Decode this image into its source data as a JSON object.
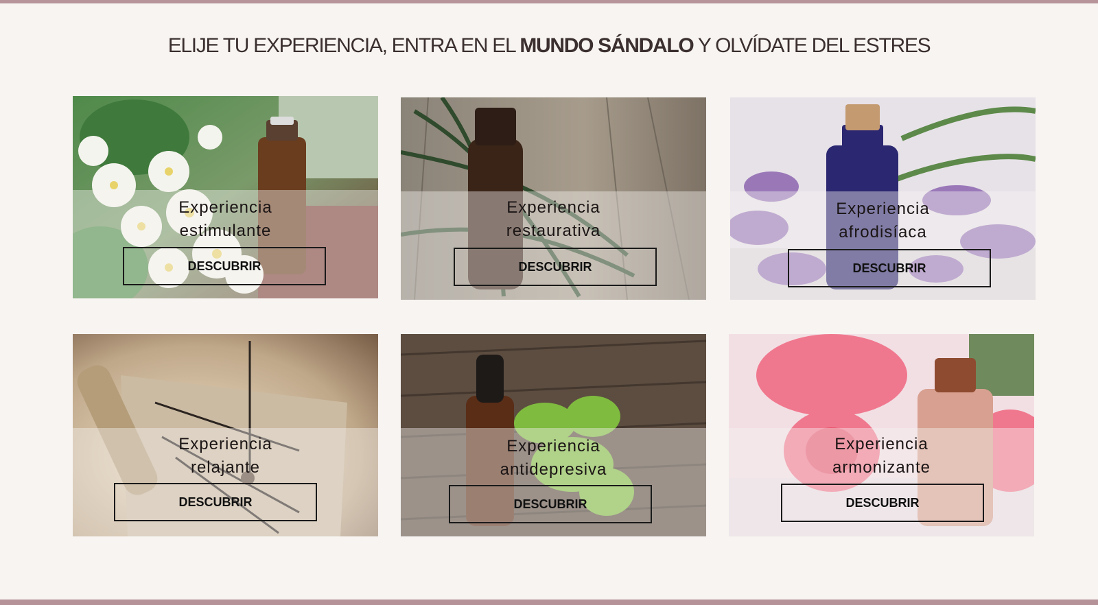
{
  "headline": {
    "prefix": "ELIJE TU EXPERIENCIA, ENTRA EN EL ",
    "brand": "MUNDO SÁNDALO",
    "suffix": " Y OLVÍDATE DEL ESTRES"
  },
  "cards": [
    {
      "title_line1": "Experiencia",
      "title_line2": "estimulante",
      "button_label": "DESCUBRIR",
      "photo_icon": "jasmine-oil-photo"
    },
    {
      "title_line1": "Experiencia",
      "title_line2": "restaurativa",
      "button_label": "DESCUBRIR",
      "photo_icon": "rosemary-oil-photo"
    },
    {
      "title_line1": "Experiencia",
      "title_line2": "afrodisíaca",
      "button_label": "DESCUBRIR",
      "photo_icon": "lavender-oil-photo"
    },
    {
      "title_line1": "Experiencia",
      "title_line2": "relajante",
      "button_label": "DESCUBRIR",
      "photo_icon": "incense-photo"
    },
    {
      "title_line1": "Experiencia",
      "title_line2": "antidepresiva",
      "button_label": "DESCUBRIR",
      "photo_icon": "basil-oil-photo"
    },
    {
      "title_line1": "Experiencia",
      "title_line2": "armonizante",
      "button_label": "DESCUBRIR",
      "photo_icon": "rose-oil-photo"
    }
  ],
  "colors": {
    "background": "#f7f4f1",
    "accent_bar": "#b7949a",
    "text": "#3b2f30"
  }
}
